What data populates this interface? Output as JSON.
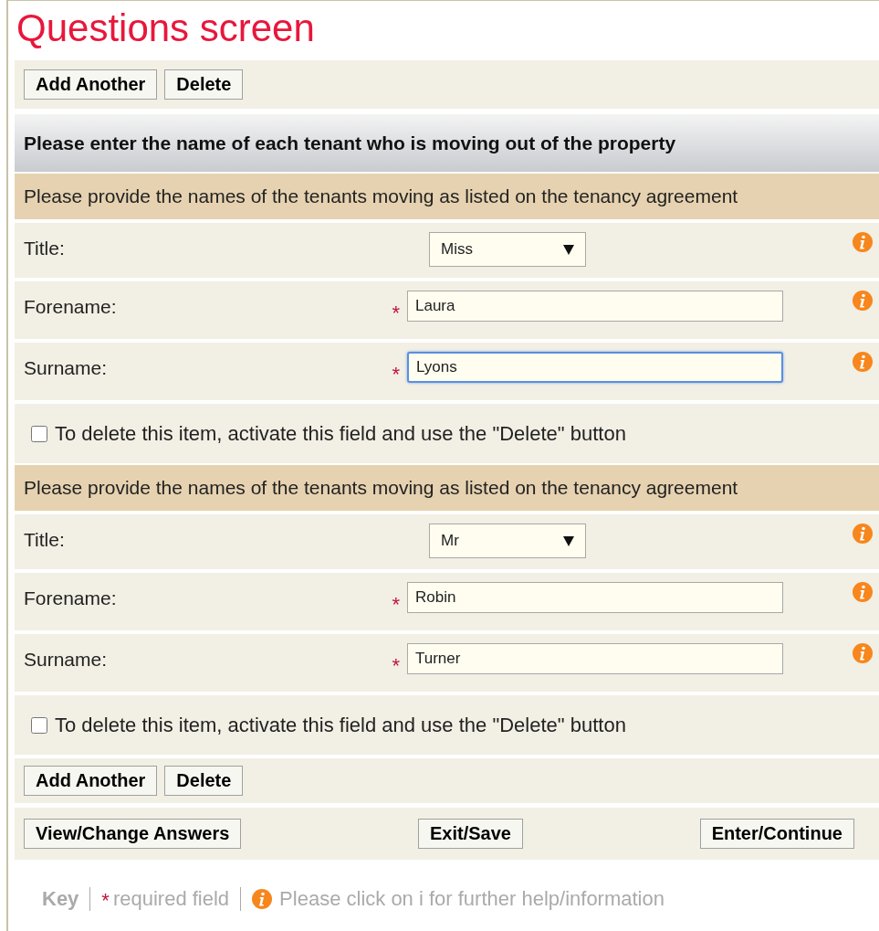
{
  "title": "Questions screen",
  "top_buttons": [
    "Add Another",
    "Delete"
  ],
  "question": "Please enter the name of each tenant who is moving out of the property",
  "tenants": [
    {
      "instruction": "Please provide the names of the tenants moving as listed on the tenancy agreement",
      "fields": [
        {
          "kind": "select",
          "label": "Title:",
          "value": "Miss",
          "required": false
        },
        {
          "kind": "text",
          "label": "Forename:",
          "value": "Laura",
          "required": true,
          "focused": false
        },
        {
          "kind": "text",
          "label": "Surname:",
          "value": "Lyons",
          "required": true,
          "focused": true
        }
      ],
      "delete_option": {
        "label": "To delete this item, activate this field and use the \"Delete\" button",
        "checked": false
      }
    },
    {
      "instruction": "Please provide the names of the tenants moving as listed on the tenancy agreement",
      "fields": [
        {
          "kind": "select",
          "label": "Title:",
          "value": "Mr",
          "required": false
        },
        {
          "kind": "text",
          "label": "Forename:",
          "value": "Robin",
          "required": true,
          "focused": false
        },
        {
          "kind": "text",
          "label": "Surname:",
          "value": "Turner",
          "required": true,
          "focused": false
        }
      ],
      "delete_option": {
        "label": "To delete this item, activate this field and use the \"Delete\" button",
        "checked": false
      }
    }
  ],
  "bottom_buttons": [
    "Add Another",
    "Delete"
  ],
  "nav_buttons": [
    "View/Change Answers",
    "Exit/Save",
    "Enter/Continue"
  ],
  "key": {
    "label": "Key",
    "required_marker": "*",
    "required_text": "required field",
    "info_text": "Please click on i for further help/information"
  }
}
